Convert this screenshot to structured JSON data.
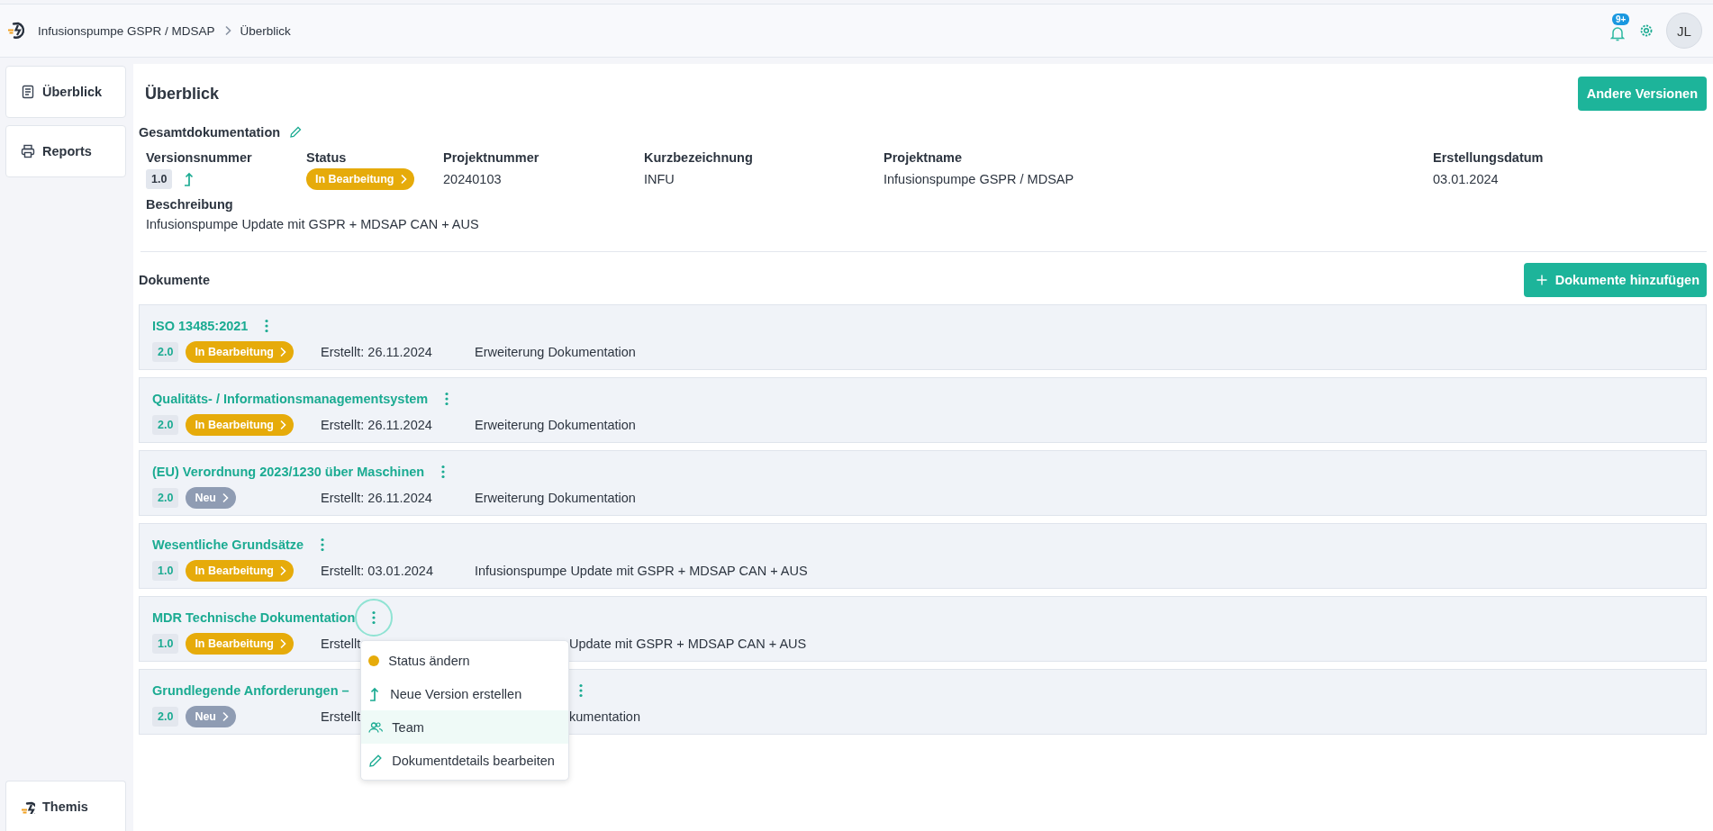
{
  "breadcrumb": [
    {
      "label": "Infusionspumpe GSPR / MDSAP"
    },
    {
      "label": "Überblick"
    }
  ],
  "header": {
    "notification_count": "9+",
    "avatar": "JL"
  },
  "sidebar": {
    "items": [
      {
        "label": "Überblick"
      },
      {
        "label": "Reports"
      }
    ],
    "footer": "Themis"
  },
  "overview": {
    "title": "Überblick",
    "button": "Andere Versionen",
    "section": "Gesamtdokumentation",
    "fields": [
      {
        "kind": "version",
        "label": "Versionsnummer",
        "value": "1.0"
      },
      {
        "kind": "status",
        "label": "Status",
        "value": "In Bearbeitung",
        "color": "#e6ab0a"
      },
      {
        "kind": "text",
        "label": "Projektnummer",
        "value": "20240103"
      },
      {
        "kind": "text",
        "label": "Kurzbezeichnung",
        "value": "INFU"
      },
      {
        "kind": "text",
        "label": "Projektname",
        "value": "Infusionspumpe GSPR / MDSAP"
      },
      {
        "kind": "text",
        "label": "Erstellungsdatum",
        "value": "03.01.2024"
      }
    ],
    "description": {
      "label": "Beschreibung",
      "value": "Infusionspumpe Update mit GSPR + MDSAP CAN + AUS"
    }
  },
  "documents": {
    "title": "Dokumente",
    "button": "Dokumente hinzufügen",
    "items": [
      {
        "title": "ISO 13485:2021",
        "version": "2.0",
        "status": "In Bearbeitung",
        "color": "#e6ab0a",
        "created": "Erstellt: 26.11.2024",
        "description": "Erweiterung Dokumentation",
        "menu_open": false,
        "covered": false
      },
      {
        "title": "Qualitäts- / Informationsmanagementsystem",
        "version": "2.0",
        "status": "In Bearbeitung",
        "color": "#e6ab0a",
        "created": "Erstellt: 26.11.2024",
        "description": "Erweiterung Dokumentation",
        "menu_open": false,
        "covered": false
      },
      {
        "title": "(EU) Verordnung 2023/1230 über Maschinen",
        "version": "2.0",
        "status": "Neu",
        "color": "#8f9cb3",
        "created": "Erstellt: 26.11.2024",
        "description": "Erweiterung Dokumentation",
        "menu_open": false,
        "covered": false
      },
      {
        "title": "Wesentliche Grundsätze",
        "version": "1.0",
        "status": "In Bearbeitung",
        "color": "#e6ab0a",
        "created": "Erstellt: 03.01.2024",
        "description": "Infusionspumpe Update mit GSPR + MDSAP CAN + AUS",
        "menu_open": false,
        "covered": false
      },
      {
        "title": "MDR Technische Dokumentation",
        "version": "1.0",
        "status": "In Bearbeitung",
        "color": "#e6ab0a",
        "created": "Erstellt",
        "description": "Update mit GSPR + MDSAP CAN + AUS",
        "menu_open": true,
        "covered": true
      },
      {
        "title": "Grundlegende Anforderungen –",
        "version": "2.0",
        "status": "Neu",
        "color": "#8f9cb3",
        "created": "Erstellt",
        "description": "kumentation",
        "menu_open": false,
        "covered": true
      }
    ]
  },
  "context_menu": {
    "items": [
      {
        "label": "Status ändern",
        "selected": false
      },
      {
        "label": "Neue Version erstellen",
        "selected": false
      },
      {
        "label": "Team",
        "selected": true
      },
      {
        "label": "Dokumentdetails bearbeiten",
        "selected": false
      }
    ]
  }
}
